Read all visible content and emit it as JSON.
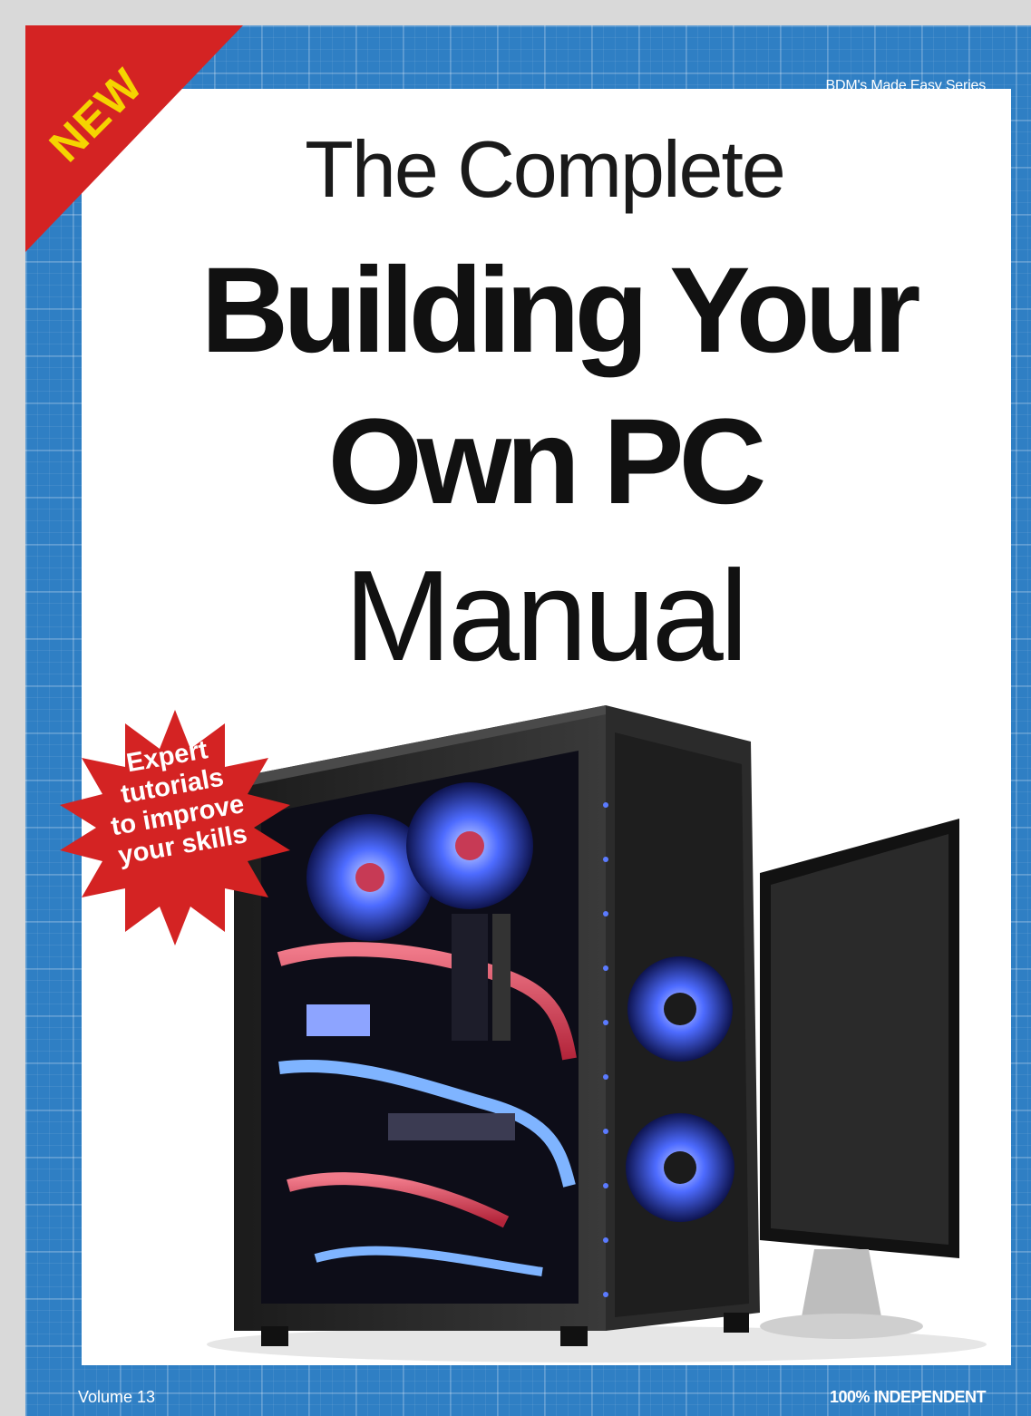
{
  "cover": {
    "series": "BDM's Made Easy Series",
    "corner_label": "NEW",
    "title_line1": "The Complete",
    "title_line2": "Building Your",
    "title_line3": "Own PC",
    "title_line4": "Manual",
    "burst_lines": [
      "Expert",
      "tutorials",
      "to improve",
      "your skills"
    ],
    "volume": "Volume 13",
    "independent": "100% INDEPENDENT"
  },
  "colors": {
    "background_blue": "#2f7fc4",
    "corner_red": "#d42323",
    "corner_text": "#f5d400",
    "burst_red": "#d42323",
    "led_blue": "#3b5bff"
  },
  "icons": {
    "burst": "starburst-badge",
    "corner": "corner-ribbon"
  }
}
